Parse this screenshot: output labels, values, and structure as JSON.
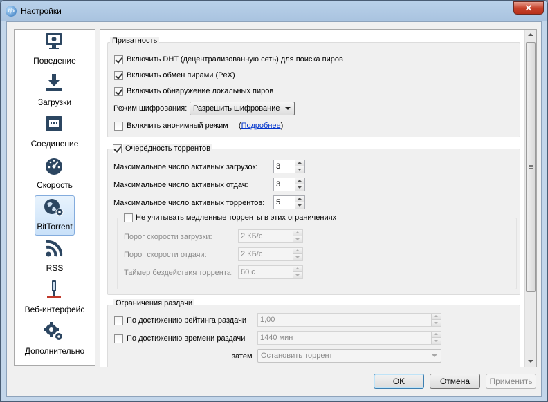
{
  "window": {
    "title": "Настройки",
    "close_symbol": "✕"
  },
  "sidebar": {
    "items": [
      {
        "id": "behavior",
        "label": "Поведение",
        "icon": "monitor-icon"
      },
      {
        "id": "downloads",
        "label": "Загрузки",
        "icon": "download-icon"
      },
      {
        "id": "connection",
        "label": "Соединение",
        "icon": "network-icon"
      },
      {
        "id": "speed",
        "label": "Скорость",
        "icon": "speedometer-icon"
      },
      {
        "id": "bittorrent",
        "label": "BitTorrent",
        "icon": "globe-gear-icon",
        "selected": true
      },
      {
        "id": "rss",
        "label": "RSS",
        "icon": "rss-icon"
      },
      {
        "id": "webui",
        "label": "Веб-интерфейс",
        "icon": "webui-icon"
      },
      {
        "id": "advanced",
        "label": "Дополнительно",
        "icon": "gears-icon"
      }
    ]
  },
  "privacy": {
    "title": "Приватность",
    "dht": {
      "label": "Включить DHT (децентрализованную сеть) для поиска пиров",
      "checked": true
    },
    "pex": {
      "label": "Включить обмен пирами (PeX)",
      "checked": true
    },
    "lsd": {
      "label": "Включить обнаружение локальных пиров",
      "checked": true
    },
    "encryption_label": "Режим шифрования:",
    "encryption_value": "Разрешить шифрование",
    "anon": {
      "label": "Включить анонимный режим",
      "checked": false,
      "link_open": "(",
      "link": "Подробнее",
      "link_close": ")"
    }
  },
  "queue": {
    "title": "Очерёдность торрентов",
    "checked": true,
    "max_downloads_label": "Максимальное число активных загрузок:",
    "max_downloads": "3",
    "max_uploads_label": "Максимальное число активных отдач:",
    "max_uploads": "3",
    "max_torrents_label": "Максимальное число активных торрентов:",
    "max_torrents": "5",
    "slow": {
      "title": "Не учитывать медленные торренты в этих ограничениях",
      "checked": false,
      "dl_rate_label": "Порог скорости загрузки:",
      "dl_rate": "2 КБ/с",
      "ul_rate_label": "Порог скорости отдачи:",
      "ul_rate": "2 КБ/с",
      "timer_label": "Таймер бездействия торрента:",
      "timer": "60 с"
    }
  },
  "seeding": {
    "title": "Ограничения раздачи",
    "ratio": {
      "label": "По достижению рейтинга раздачи",
      "checked": false,
      "value": "1,00"
    },
    "time": {
      "label": "По достижению времени раздачи",
      "checked": false,
      "value": "1440 мин"
    },
    "then_label": "затем",
    "then_value": "Остановить торрент"
  },
  "buttons": {
    "ok": "OK",
    "cancel": "Отмена",
    "apply": "Применить"
  }
}
